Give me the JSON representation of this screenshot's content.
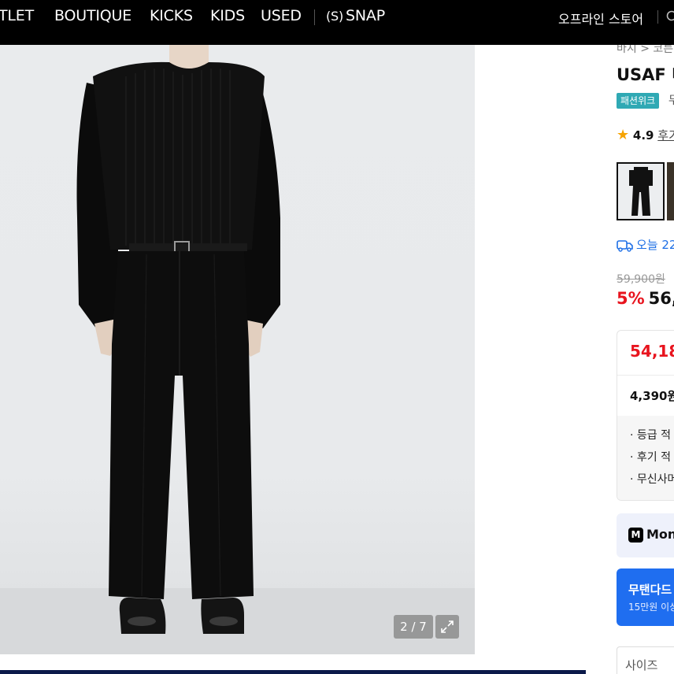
{
  "nav": {
    "items": [
      "TLET",
      "BOUTIQUE",
      "KICKS",
      "KIDS",
      "USED"
    ],
    "snap_prefix": "(S)",
    "snap_label": "SNAP",
    "offline_store": "오프라인 스토어"
  },
  "gallery": {
    "counter": "2 / 7"
  },
  "product": {
    "breadcrumb": "바지 > 코튼",
    "title": "USAF 미",
    "badge": "패션위크",
    "badge_extra": "무",
    "rating": "4.9",
    "review_label": "후기",
    "delivery": "오늘 22",
    "original_price": "59,900원",
    "discount_rate": "5%",
    "sale_price": "56,",
    "benefit_price": "54,18",
    "point": "4,390원",
    "benefits": [
      "· 등급 적",
      "· 후기 적",
      "· 무신사머"
    ],
    "money_label": "Mone",
    "promo_title": "무탠다드",
    "promo_sub": "15만원 이상",
    "size_label": "사이즈"
  },
  "colors": {
    "nav_bg": "#000000",
    "discount_red": "#e8141e",
    "delivery_blue": "#1e6fe6",
    "promo_blue": "#1f6ef0",
    "badge_teal": "#2fa9b4"
  }
}
